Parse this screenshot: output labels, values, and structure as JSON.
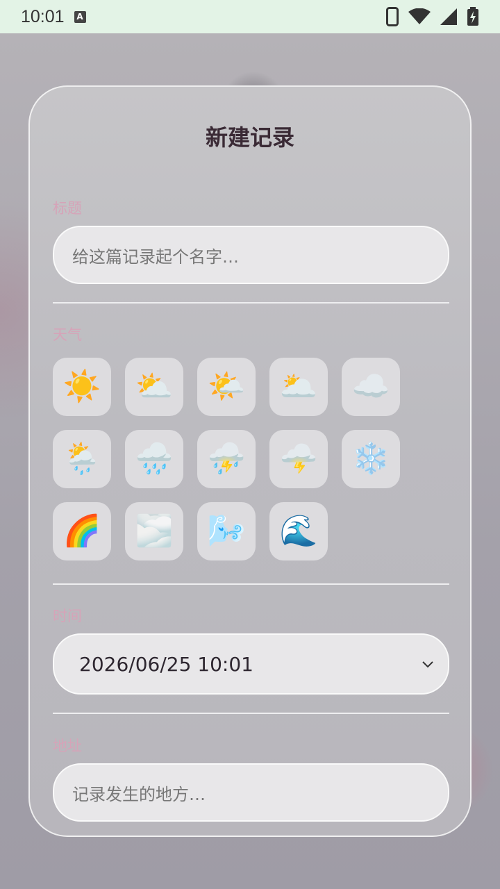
{
  "status_bar": {
    "time": "10:01",
    "a_icon_label": "A"
  },
  "dialog": {
    "title": "新建记录",
    "title_section": {
      "label": "标题",
      "placeholder": "给这篇记录起个名字…"
    },
    "weather_section": {
      "label": "天气",
      "options": [
        {
          "icon": "sun-icon",
          "glyph": "☀️"
        },
        {
          "icon": "sun-behind-cloud-icon",
          "glyph": "⛅"
        },
        {
          "icon": "sun-behind-small-cloud-icon",
          "glyph": "🌤️"
        },
        {
          "icon": "sun-behind-large-cloud-icon",
          "glyph": "🌥️"
        },
        {
          "icon": "cloud-icon",
          "glyph": "☁️"
        },
        {
          "icon": "sun-behind-rain-cloud-icon",
          "glyph": "🌦️"
        },
        {
          "icon": "rain-cloud-icon",
          "glyph": "🌧️"
        },
        {
          "icon": "thunder-rain-cloud-icon",
          "glyph": "⛈️"
        },
        {
          "icon": "lightning-cloud-icon",
          "glyph": "🌩️"
        },
        {
          "icon": "snowflake-icon",
          "glyph": "❄️"
        },
        {
          "icon": "rainbow-icon",
          "glyph": "🌈"
        },
        {
          "icon": "fog-icon",
          "glyph": "🌫️"
        },
        {
          "icon": "wind-face-icon",
          "glyph": "🌬️"
        },
        {
          "icon": "water-wave-icon",
          "glyph": "🌊"
        }
      ]
    },
    "time_section": {
      "label": "时间",
      "value": "2026/06/25 10:01"
    },
    "address_section": {
      "label": "地址",
      "placeholder": "记录发生的地方…"
    }
  }
}
